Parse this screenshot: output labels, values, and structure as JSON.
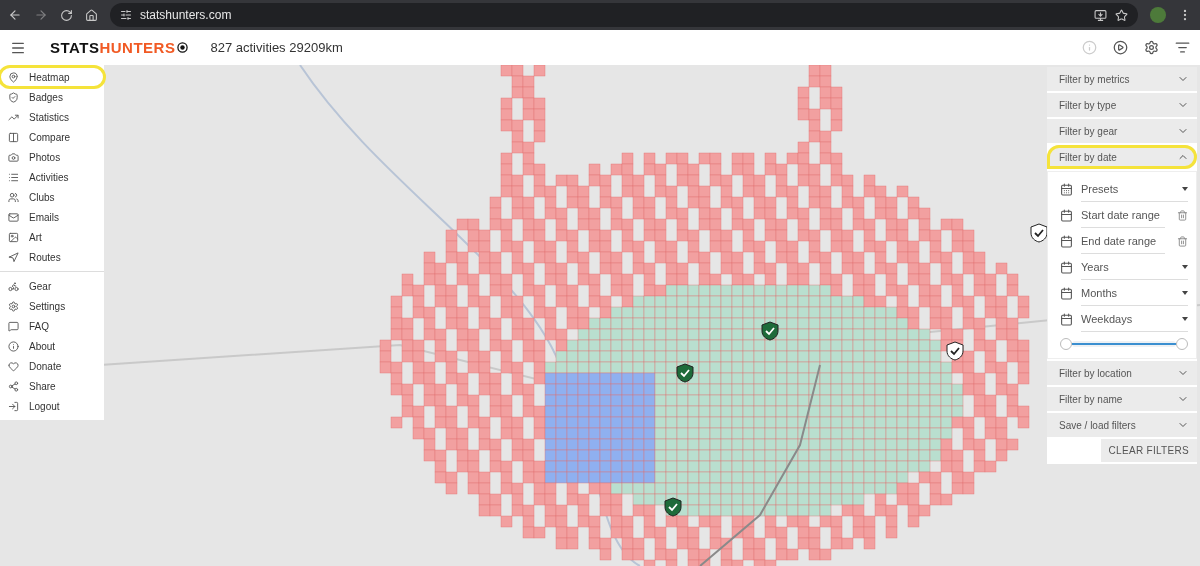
{
  "browser": {
    "url": "statshunters.com"
  },
  "header": {
    "logo_part1": "STATS",
    "logo_part2": "HUNTERS",
    "summary": "827 activities 29209km"
  },
  "menu": {
    "groups": [
      [
        {
          "label": "Heatmap",
          "highlighted": true
        },
        {
          "label": "Badges",
          "highlighted": false
        },
        {
          "label": "Statistics",
          "highlighted": false
        },
        {
          "label": "Compare",
          "highlighted": false
        },
        {
          "label": "Photos",
          "highlighted": false
        },
        {
          "label": "Activities",
          "highlighted": false
        },
        {
          "label": "Clubs",
          "highlighted": false
        },
        {
          "label": "Emails",
          "highlighted": false
        },
        {
          "label": "Art",
          "highlighted": false
        },
        {
          "label": "Routes",
          "highlighted": false
        }
      ],
      [
        {
          "label": "Gear",
          "highlighted": false
        },
        {
          "label": "Settings",
          "highlighted": false
        },
        {
          "label": "FAQ",
          "highlighted": false
        },
        {
          "label": "About",
          "highlighted": false
        },
        {
          "label": "Donate",
          "highlighted": false
        },
        {
          "label": "Share",
          "highlighted": false
        },
        {
          "label": "Logout",
          "highlighted": false
        }
      ]
    ]
  },
  "filters": {
    "sections": [
      {
        "title": "Filter by metrics",
        "expanded": false,
        "highlighted": false
      },
      {
        "title": "Filter by type",
        "expanded": false,
        "highlighted": false
      },
      {
        "title": "Filter by gear",
        "expanded": false,
        "highlighted": false
      },
      {
        "title": "Filter by date",
        "expanded": true,
        "highlighted": true,
        "fields": [
          {
            "label": "Presets",
            "kind": "select"
          },
          {
            "label": "Start date range",
            "kind": "date"
          },
          {
            "label": "End date range",
            "kind": "date"
          },
          {
            "label": "Years",
            "kind": "select"
          },
          {
            "label": "Months",
            "kind": "select"
          },
          {
            "label": "Weekdays",
            "kind": "select"
          }
        ],
        "slider": {
          "level": 1
        }
      },
      {
        "title": "Filter by location",
        "expanded": false,
        "highlighted": false
      },
      {
        "title": "Filter by name",
        "expanded": false,
        "highlighted": false
      },
      {
        "title": "Save / load filters",
        "expanded": false,
        "highlighted": false
      }
    ],
    "clear_button": "CLEAR FILTERS"
  }
}
